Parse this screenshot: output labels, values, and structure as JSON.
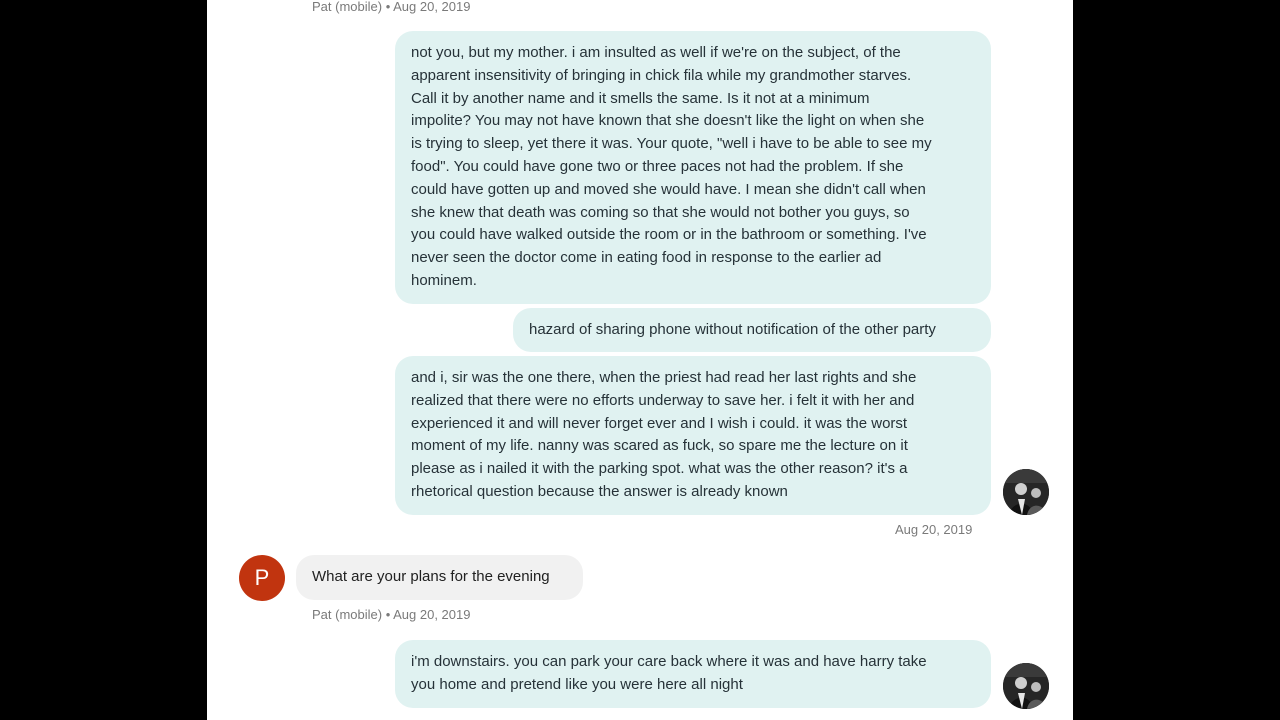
{
  "colors": {
    "outgoing_bubble": "#e0f2f1",
    "incoming_bubble": "#f1f1f1",
    "contact_avatar": "#c1340f",
    "background": "#ffffff",
    "letterbox": "#000000"
  },
  "conversation": {
    "top_meta": "Pat (mobile) • Aug 20, 2019",
    "messages": [
      {
        "text": "not you, but my mother.  i am insulted as well if we're on the subject, of the\napparent insensitivity of bringing in chick fila while my grandmother starves.\nCall it by another name and it smells the same.  Is it not at a minimum\nimpolite?  You may not have known that she doesn't like the light on when she\nis trying to sleep, yet there it was.  Your quote, \"well i have to be able to see my\nfood\".   You could have gone two or three paces not had the problem.  If she\ncould have gotten up and moved she would have.   I mean she didn't call when\nshe knew that death was coming so that she would not bother you guys,  so\nyou could have walked outside the room or in the bathroom or something.  I've\nnever seen the doctor come in eating food in response to the earlier ad\nhominem."
      },
      {
        "text": "hazard of sharing phone without notification of the other party"
      },
      {
        "text": "and i, sir was the one there, when the priest had read her last rights and she\nrealized that there were no efforts underway to save her.  i felt it with her and\nexperienced it and will never forget ever and I wish i could.  it was the worst\nmoment of my life.  nanny was scared as fuck, so spare me the lecture on it\nplease as i nailed it with the parking spot.  what was the other reason?  it's a\nrhetorical question because the answer is already known"
      },
      {
        "timestamp": "Aug 20, 2019"
      },
      {
        "avatar_letter": "P",
        "text": "What are your plans for the evening",
        "meta": "Pat (mobile) • Aug 20, 2019"
      },
      {
        "text": "i'm downstairs. you can park your care back where it was and have harry take\nyou home and pretend like you were here all night"
      }
    ]
  }
}
